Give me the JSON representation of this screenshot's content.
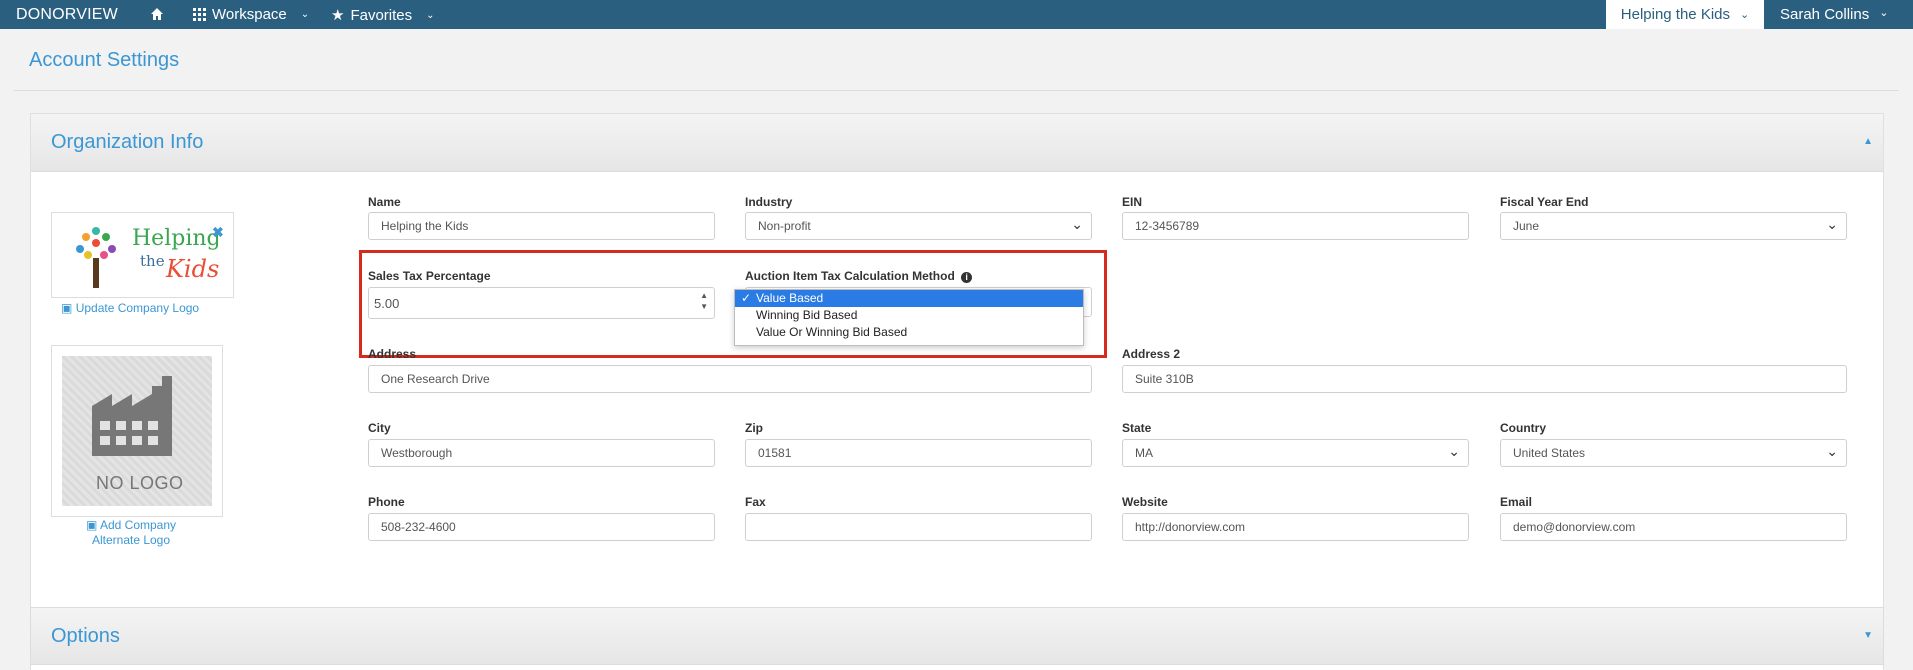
{
  "navbar": {
    "brand": "DONORVIEW",
    "workspace": "Workspace",
    "favorites": "Favorites",
    "org": "Helping the Kids",
    "user": "Sarah Collins"
  },
  "page": {
    "title": "Account Settings"
  },
  "org_panel": {
    "title": "Organization Info",
    "logo_text": [
      "Helping",
      "the",
      "Kids"
    ],
    "update_logo": "Update Company Logo",
    "nologo_text": "NO LOGO",
    "add_alt_logo": "Add Company Alternate Logo",
    "fields": {
      "name": {
        "label": "Name",
        "value": "Helping the Kids"
      },
      "industry": {
        "label": "Industry",
        "value": "Non-profit"
      },
      "ein": {
        "label": "EIN",
        "value": "12-3456789"
      },
      "fiscal_year_end": {
        "label": "Fiscal Year End",
        "value": "June"
      },
      "sales_tax": {
        "label": "Sales Tax Percentage",
        "value": "5.00"
      },
      "auction_tax_method": {
        "label": "Auction Item Tax Calculation Method",
        "options": [
          "Value Based",
          "Winning Bid Based",
          "Value Or Winning Bid Based"
        ],
        "selected": "Value Based"
      },
      "address": {
        "label": "Address",
        "value": "One Research Drive"
      },
      "address2": {
        "label": "Address 2",
        "value": "Suite 310B"
      },
      "city": {
        "label": "City",
        "value": "Westborough"
      },
      "zip": {
        "label": "Zip",
        "value": "01581"
      },
      "state": {
        "label": "State",
        "value": "MA"
      },
      "country": {
        "label": "Country",
        "value": "United States"
      },
      "phone": {
        "label": "Phone",
        "value": "508-232-4600"
      },
      "fax": {
        "label": "Fax",
        "value": ""
      },
      "website": {
        "label": "Website",
        "value": "http://donorview.com"
      },
      "email": {
        "label": "Email",
        "value": "demo@donorview.com"
      }
    }
  },
  "options_panel": {
    "title": "Options"
  },
  "colors": {
    "navbar": "#2b5f80",
    "accent": "#3a97d4",
    "highlight": "#d62a1e",
    "selected_option": "#2a7be4"
  }
}
